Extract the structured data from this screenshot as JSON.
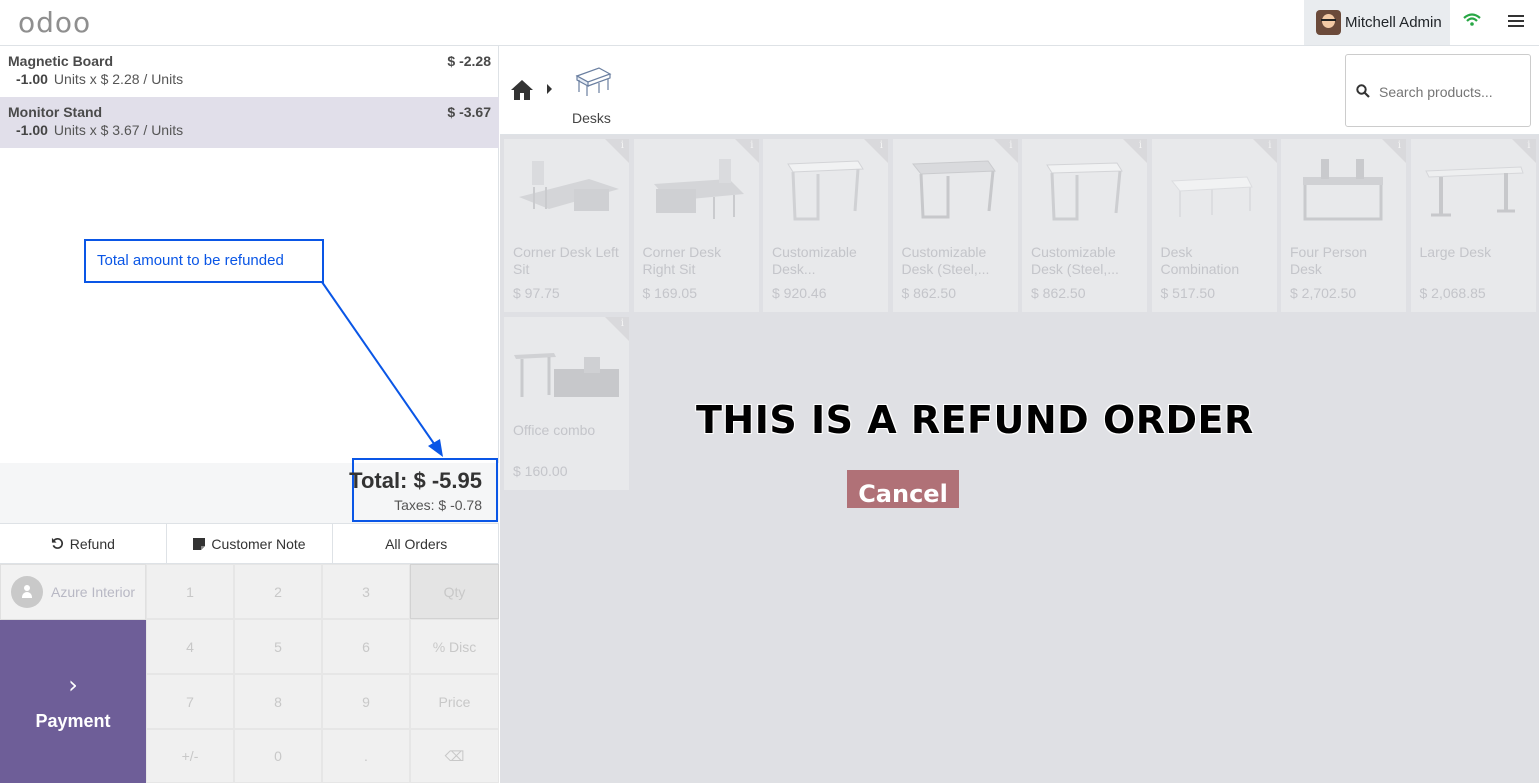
{
  "topbar": {
    "logo_text": "odoo",
    "user_name": "Mitchell Admin"
  },
  "order": {
    "lines": [
      {
        "name": "Magnetic Board",
        "price": "$ -2.28",
        "qty": "-1.00",
        "detail": "Units x $ 2.28 / Units"
      },
      {
        "name": "Monitor Stand",
        "price": "$ -3.67",
        "qty": "-1.00",
        "detail": "Units x $ 3.67 / Units"
      }
    ],
    "total": "Total: $ -5.95",
    "taxes": "Taxes: $ -0.78"
  },
  "annotation": {
    "text": "Total amount to be refunded",
    "color": "#0a56e6"
  },
  "controls": {
    "refund": "Refund",
    "customer_note": "Customer Note",
    "all_orders": "All Orders"
  },
  "customer": {
    "name": "Azure Interior"
  },
  "payment": {
    "label": "Payment",
    "color": "#6e5e98"
  },
  "numpad": {
    "keys": [
      "1",
      "2",
      "3",
      "Qty",
      "4",
      "5",
      "6",
      "% Disc",
      "7",
      "8",
      "9",
      "Price",
      "+/-",
      "0",
      ".",
      "⌫"
    ]
  },
  "category": {
    "current": "Desks"
  },
  "search": {
    "placeholder": "Search products..."
  },
  "products": [
    {
      "name": "Corner Desk Left Sit",
      "price": "$ 97.75",
      "icon": "corner-desk-left-image"
    },
    {
      "name": "Corner Desk Right Sit",
      "price": "$ 169.05",
      "icon": "corner-desk-right-image"
    },
    {
      "name": "Customizable Desk...",
      "price": "$ 920.46",
      "icon": "customizable-desk-image"
    },
    {
      "name": "Customizable Desk (Steel,...",
      "price": "$ 862.50",
      "icon": "customizable-desk-steel-image"
    },
    {
      "name": "Customizable Desk (Steel,...",
      "price": "$ 862.50",
      "icon": "customizable-desk-steel-image"
    },
    {
      "name": "Desk Combination",
      "price": "$ 517.50",
      "icon": "desk-combination-image"
    },
    {
      "name": "Four Person Desk",
      "price": "$ 2,702.50",
      "icon": "four-person-desk-image"
    },
    {
      "name": "Large Desk",
      "price": "$ 2,068.85",
      "icon": "large-desk-image"
    },
    {
      "name": "Office combo",
      "price": "$ 160.00",
      "icon": "office-combo-image"
    }
  ],
  "refund_banner": {
    "title": "THIS IS A REFUND ORDER",
    "cancel": "Cancel",
    "cancel_color": "#b07177"
  }
}
